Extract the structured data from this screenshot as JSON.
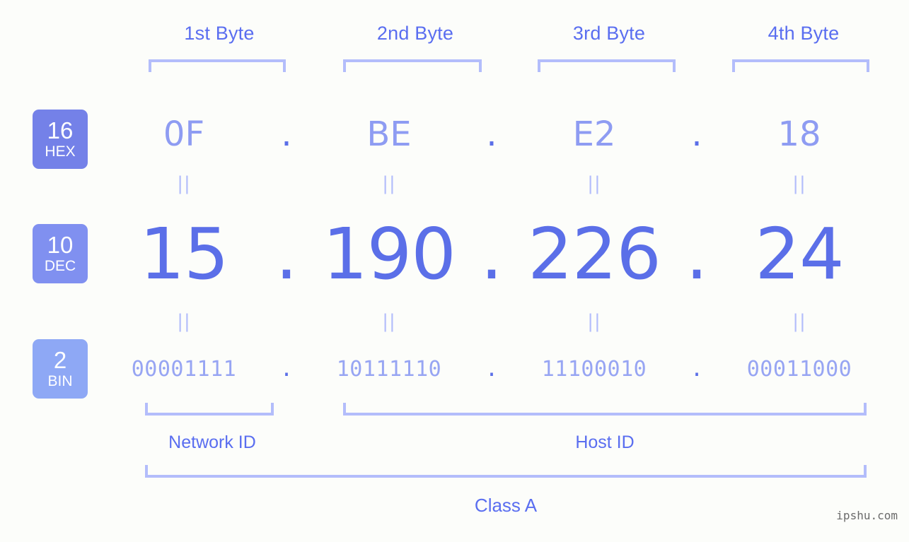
{
  "meta": {
    "background_color": "#fcfdfa",
    "accent_color": "#5b6fe8",
    "light_accent_color": "#b3bdfb",
    "watermark": "ipshu.com"
  },
  "byte_headers": [
    {
      "label": "1st Byte"
    },
    {
      "label": "2nd Byte"
    },
    {
      "label": "3rd Byte"
    },
    {
      "label": "4th Byte"
    }
  ],
  "radix_badges": [
    {
      "num": "16",
      "sub": "HEX",
      "color": "#7481e8"
    },
    {
      "num": "10",
      "sub": "DEC",
      "color": "#8090f0"
    },
    {
      "num": "2",
      "sub": "BIN",
      "color": "#8ea8f5"
    }
  ],
  "separators": {
    "dot": ".",
    "equals": "||"
  },
  "rows": {
    "hex": {
      "name": "hexadecimal",
      "octets": [
        "0F",
        "BE",
        "E2",
        "18"
      ]
    },
    "dec": {
      "name": "decimal",
      "octets": [
        "15",
        "190",
        "226",
        "24"
      ]
    },
    "bin": {
      "name": "binary",
      "octets": [
        "00001111",
        "10111110",
        "11100010",
        "00011000"
      ]
    }
  },
  "partitions": {
    "network_id_label": "Network ID",
    "host_id_label": "Host ID",
    "class_label": "Class A"
  }
}
